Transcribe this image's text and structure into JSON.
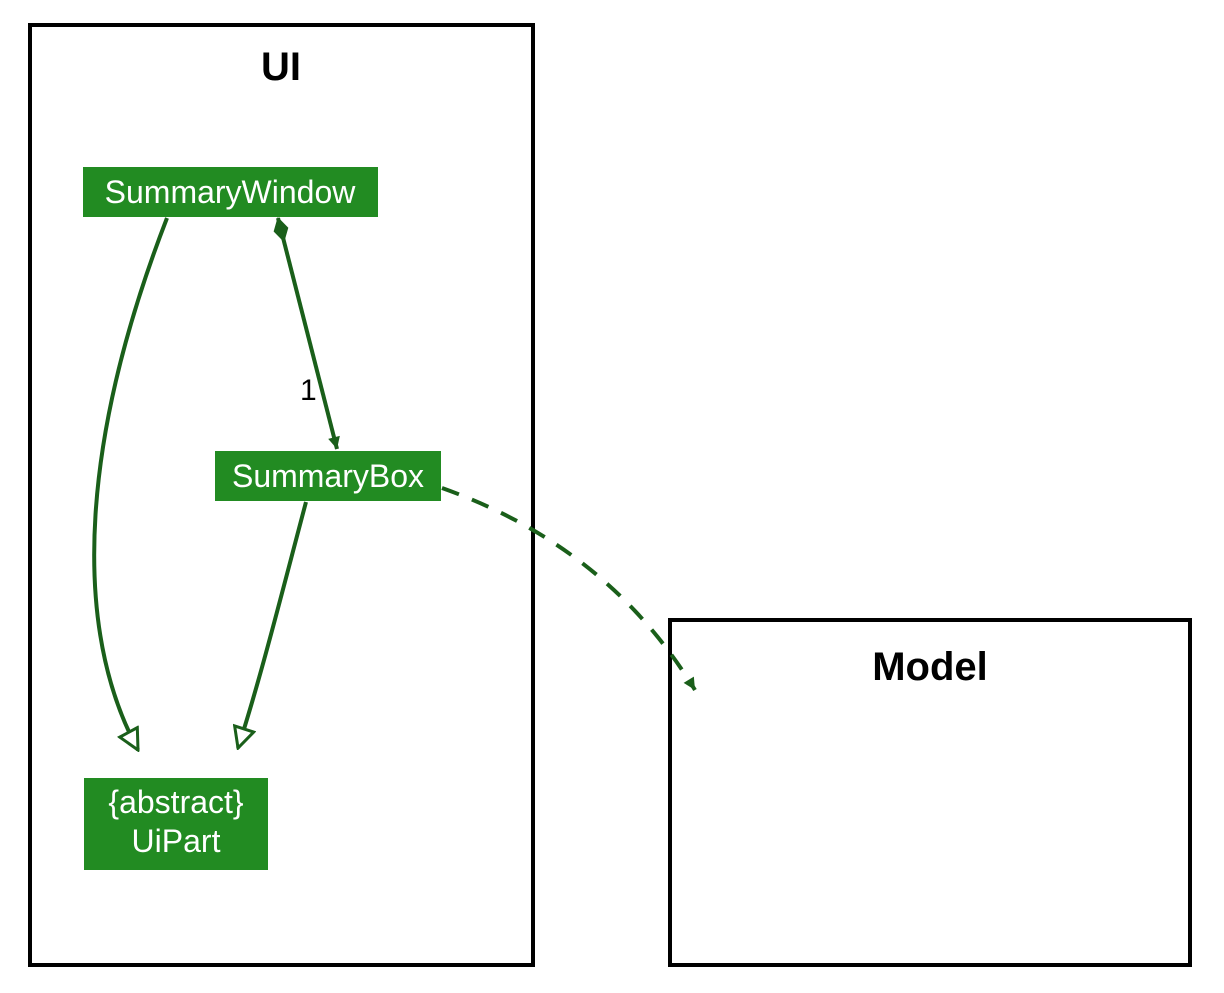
{
  "diagram": {
    "type": "uml-class-diagram",
    "packages": {
      "ui": {
        "title": "UI"
      },
      "model": {
        "title": "Model"
      }
    },
    "classes": {
      "summaryWindow": {
        "name": "SummaryWindow"
      },
      "summaryBox": {
        "name": "SummaryBox"
      },
      "uiPart": {
        "stereotype": "{abstract}",
        "name": "UiPart"
      }
    },
    "relations": {
      "composition_window_box": {
        "multiplicity": "1",
        "kind": "composition",
        "from": "summaryWindow",
        "to": "summaryBox"
      },
      "generalization_window_uipart": {
        "kind": "generalization",
        "from": "summaryWindow",
        "to": "uiPart"
      },
      "generalization_box_uipart": {
        "kind": "generalization",
        "from": "summaryBox",
        "to": "uiPart"
      },
      "dependency_box_model": {
        "kind": "dependency",
        "from": "summaryBox",
        "to": "model"
      }
    },
    "colors": {
      "classFill": "#228B22",
      "edge": "#1a5f1a",
      "border": "#000000"
    }
  }
}
